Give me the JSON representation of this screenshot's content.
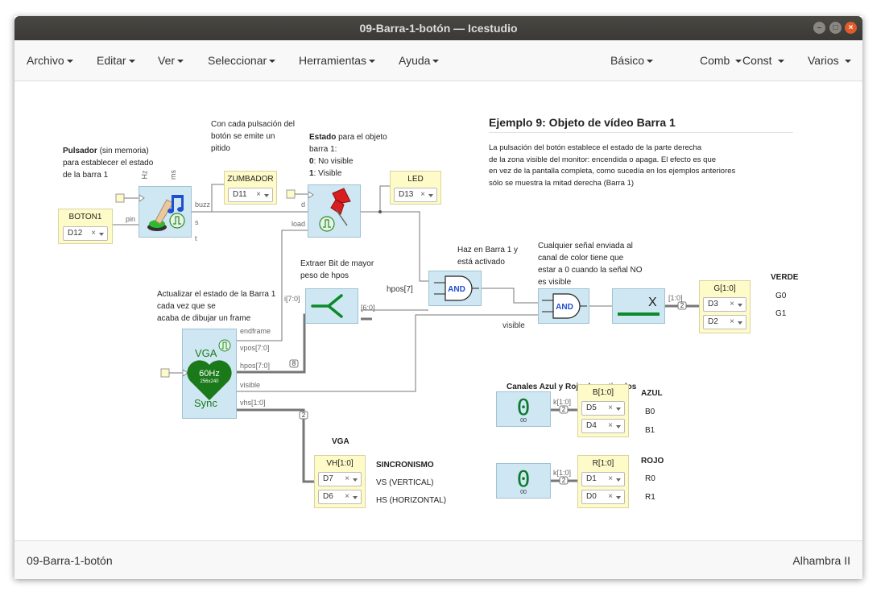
{
  "window": {
    "title": "09-Barra-1-botón — Icestudio"
  },
  "menu_left": [
    "Archivo",
    "Editar",
    "Ver",
    "Seleccionar",
    "Herramientas",
    "Ayuda"
  ],
  "menu_right": [
    "Básico",
    "Comb",
    "Const",
    "Varios"
  ],
  "footer": {
    "left": "09-Barra-1-botón",
    "right": "Alhambra II"
  },
  "colors": {
    "titlebar": "#3c3b37",
    "close_button": "#e25a2a",
    "block_blue": "#cfe7f2",
    "io_yellow": "#fffbc8",
    "green": "#0a7a2a"
  },
  "icons": [
    "pushbutton-icon",
    "music-note-icon",
    "pushpin-icon",
    "pulse-icon",
    "split-icon",
    "and-gate-icon",
    "heart-icon"
  ],
  "title_block": {
    "heading": "Ejemplo 9: Objeto de vídeo Barra 1",
    "lines": [
      "La pulsación del botón establece el estado de la parte derecha",
      "de la zona visible del monitor: encendida o apaga. El efecto es que",
      "en vez de la pantalla completa, como sucedía en los ejemplos anteriores",
      "sólo se muestra la mitad derecha (Barra 1)"
    ]
  },
  "notes": {
    "pulsador": {
      "bold": "Pulsador",
      "rest": " (sin memoria)",
      "lines": [
        "para establecer el estado",
        "de la barra 1"
      ]
    },
    "zumbador": [
      "Con cada pulsación del",
      "botón se emite un",
      "pitido"
    ],
    "estado": {
      "bold": "Estado",
      "rest": " para el objeto",
      "line2": "barra 1:",
      "l3b": "0",
      "l3": ": No visible",
      "l4b": "1",
      "l4": ": Visible"
    },
    "extraer": [
      "Extraer Bit de mayor",
      "peso de hpos"
    ],
    "hazbarra": [
      "Haz en Barra 1 y",
      "está activado"
    ],
    "cualquier": [
      "Cualquier señal enviada al",
      "canal de color tiene que",
      "estar a 0 cuando la señal NO",
      "es visible"
    ],
    "actualizar": [
      "Actualizar el estado de la Barra 1",
      "cada vez que se",
      "acaba de dibujar un frame"
    ],
    "canales": "Canales Azul y Rojo desactivados",
    "verde": "VERDE",
    "g0": "G0",
    "g1": "G1",
    "azul": "AZUL",
    "b0": "B0",
    "b1": "B1",
    "rojo": "ROJO",
    "r0": "R0",
    "r1": "R1",
    "vga": "VGA",
    "sincronismo": "SINCRONISMO",
    "vs": "VS (VERTICAL)",
    "hs": "HS (HORIZONTAL)"
  },
  "io_blocks": {
    "boton1": {
      "label": "BOTON1",
      "pins": [
        "D12"
      ]
    },
    "zumbador": {
      "label": "ZUMBADOR",
      "pins": [
        "D11"
      ]
    },
    "led": {
      "label": "LED",
      "pins": [
        "D13"
      ]
    },
    "g": {
      "label": "G[1:0]",
      "pins": [
        "D3",
        "D2"
      ]
    },
    "b": {
      "label": "B[1:0]",
      "pins": [
        "D5",
        "D4"
      ]
    },
    "r": {
      "label": "R[1:0]",
      "pins": [
        "D1",
        "D0"
      ]
    },
    "vh": {
      "label": "VH[1:0]",
      "pins": [
        "D7",
        "D6"
      ]
    }
  },
  "ports": {
    "hz": "Hz",
    "ms": "ms",
    "buzz": "buzz",
    "s": "s",
    "t": "t",
    "pin": "pin",
    "d": "d",
    "load": "load",
    "hpos7": "hpos[7]",
    "i70": "i[7:0]",
    "b60": "[6:0]",
    "endframe": "endframe",
    "vpos": "vpos[7:0]",
    "hpos": "hpos[7:0]",
    "visible": "visible",
    "vhs": "vhs[1:0]",
    "visible_wire": "visible",
    "and_label": "AND",
    "x_label": "X",
    "k10": "k[1:0]",
    "range10": "[1:0]",
    "bus8": "8",
    "bus2": "2"
  },
  "vga_sync": {
    "top": "VGA",
    "freq": "60Hz",
    "res": "256x240",
    "bottom": "Sync"
  },
  "consts": {
    "b_value": "0",
    "b_sub": "00",
    "r_value": "0",
    "r_sub": "00"
  }
}
